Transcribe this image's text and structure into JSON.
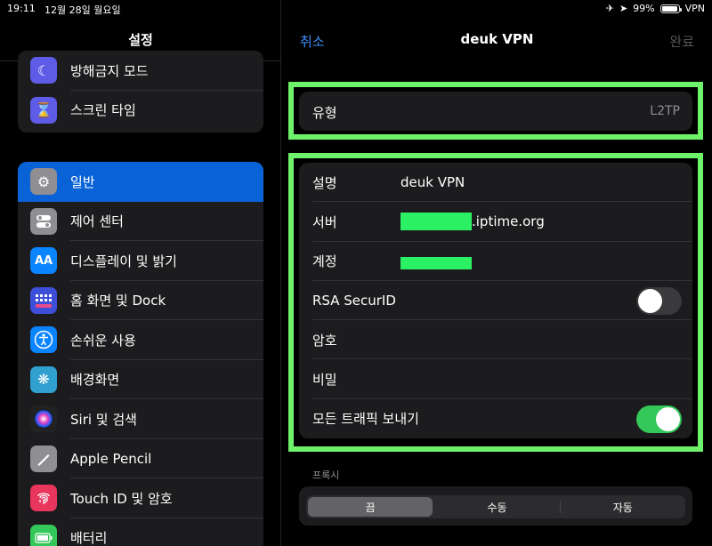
{
  "status": {
    "time": "19:11",
    "date": "12월 28일 월요일",
    "battery": "99%",
    "vpn": "VPN",
    "battery_level": 0.99
  },
  "sidebar": {
    "title": "설정",
    "group1": [
      {
        "label": "방해금지 모드",
        "icon": "moon-icon",
        "color": "#5e5ce6"
      },
      {
        "label": "스크린 타임",
        "icon": "hourglass-icon",
        "color": "#5e5ce6"
      }
    ],
    "group2": [
      {
        "label": "일반",
        "icon": "gear-icon",
        "color": "#8e8e93",
        "selected": true
      },
      {
        "label": "제어 센터",
        "icon": "toggles-icon",
        "color": "#8e8e93"
      },
      {
        "label": "디스플레이 및 밝기",
        "icon": "text-size-icon",
        "color": "#0a84ff"
      },
      {
        "label": "홈 화면 및 Dock",
        "icon": "grid-icon",
        "color": "#3d4fd9"
      },
      {
        "label": "손쉬운 사용",
        "icon": "accessibility-icon",
        "color": "#0a84ff"
      },
      {
        "label": "배경화면",
        "icon": "flower-icon",
        "color": "#30a0d0"
      },
      {
        "label": "Siri 및 검색",
        "icon": "siri-icon",
        "color": "#222"
      },
      {
        "label": "Apple Pencil",
        "icon": "pencil-icon",
        "color": "#8e8e93"
      },
      {
        "label": "Touch ID 및 암호",
        "icon": "fingerprint-icon",
        "color": "#e8365d"
      },
      {
        "label": "배터리",
        "icon": "battery-icon",
        "color": "#34c759"
      }
    ]
  },
  "nav": {
    "cancel": "취소",
    "title": "deuk VPN",
    "done": "완료"
  },
  "type_row": {
    "label": "유형",
    "value": "L2TP"
  },
  "form": {
    "description": {
      "label": "설명",
      "value": "deuk VPN"
    },
    "server": {
      "label": "서버",
      "value_suffix": ".iptime.org"
    },
    "account": {
      "label": "계정"
    },
    "rsa": {
      "label": "RSA SecurID",
      "on": false
    },
    "password": {
      "label": "암호"
    },
    "secret": {
      "label": "비밀"
    },
    "send_all": {
      "label": "모든 트래픽 보내기",
      "on": true
    }
  },
  "proxy": {
    "label": "프록시",
    "options": [
      "끔",
      "수동",
      "자동"
    ],
    "selected": 0
  },
  "colors": {
    "accent": "#3a8ff7",
    "selected_row": "#0a63d6",
    "highlight": "#6ef26a",
    "toggle_on": "#34c759"
  }
}
